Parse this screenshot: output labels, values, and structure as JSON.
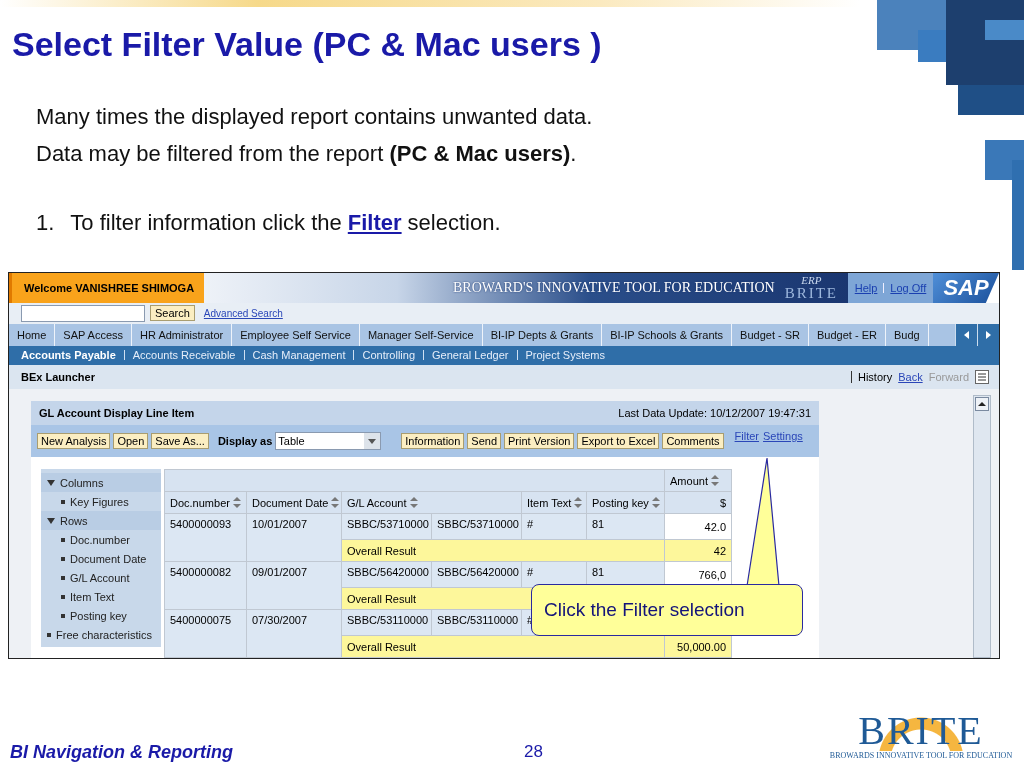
{
  "slide": {
    "title": "Select Filter Value (PC & Mac users )",
    "paragraphs": [
      "Many times the displayed report contains unwanted data.",
      "Data may be filtered from the report **(PC & Mac users)**."
    ],
    "step": {
      "number": "1.",
      "text_before": "To filter information click the",
      "link": "Filter",
      "text_after": "selection."
    }
  },
  "portal": {
    "welcome": "Welcome VANISHREE SHIMOGA",
    "banner": {
      "title": "BROWARD'S INNOVATIVE TOOL FOR EDUCATION",
      "erp": "ERP",
      "brand": "BRITE"
    },
    "header_links": [
      "Help",
      "Log Off"
    ],
    "sap_logo": "SAP",
    "search": {
      "button": "Search",
      "advanced": "Advanced Search"
    },
    "tabs": [
      {
        "label": "Home",
        "selected": false
      },
      {
        "label": "SAP Access",
        "selected": false
      },
      {
        "label": "HR Administrator",
        "selected": false
      },
      {
        "label": "Employee Self Service",
        "selected": false
      },
      {
        "label": "Manager Self-Service",
        "selected": false
      },
      {
        "label": "BI-IP Depts & Grants",
        "selected": false
      },
      {
        "label": "BI-IP Schools & Grants",
        "selected": false
      },
      {
        "label": "Budget - SR",
        "selected": false
      },
      {
        "label": "Budget - ER",
        "selected": false
      },
      {
        "label": "Budg",
        "selected": false
      }
    ],
    "subnav": [
      {
        "label": "Accounts Payable",
        "selected": true
      },
      {
        "label": "Accounts Receivable",
        "selected": false
      },
      {
        "label": "Cash Management",
        "selected": false
      },
      {
        "label": "Controlling",
        "selected": false
      },
      {
        "label": "General Ledger",
        "selected": false
      },
      {
        "label": "Project Systems",
        "selected": false
      }
    ],
    "launcher": {
      "title": "BEx Launcher",
      "history": "History",
      "back": "Back",
      "forward": {
        "label": "Forward",
        "disabled": true
      }
    },
    "report": {
      "title": "GL Account Display Line Item",
      "last_update": "Last Data Update: 10/12/2007 19:47:31",
      "buttons_left": [
        "New Analysis",
        "Open",
        "Save As..."
      ],
      "display_as_label": "Display as",
      "display_as_value": "Table",
      "buttons_right": [
        "Information",
        "Send",
        "Print Version",
        "Export to Excel",
        "Comments"
      ],
      "links": [
        "Filter",
        "Settings"
      ],
      "navigation": [
        {
          "label": "Columns",
          "expanded": true,
          "children": [
            {
              "label": "Key Figures"
            }
          ]
        },
        {
          "label": "Rows",
          "expanded": true,
          "children": [
            {
              "label": "Doc.number"
            },
            {
              "label": "Document Date"
            },
            {
              "label": "G/L Account"
            },
            {
              "label": "Item Text"
            },
            {
              "label": "Posting key"
            }
          ]
        },
        {
          "label": "Free characteristics",
          "expanded": false
        }
      ],
      "table": {
        "amount_heading": "Amount",
        "columns": [
          {
            "label": "Doc.number",
            "sortable": true,
            "kind": "single"
          },
          {
            "label": "Document Date",
            "sortable": true,
            "kind": "single"
          },
          {
            "label": "G/L Account",
            "sortable": true,
            "kind": "pair"
          },
          {
            "label": "Item Text",
            "sortable": true,
            "kind": "single"
          },
          {
            "label": "Posting key",
            "sortable": true,
            "kind": "single"
          },
          {
            "label": "$",
            "sortable": false,
            "kind": "single"
          }
        ],
        "rows": [
          {
            "doc": "5400000093",
            "date": "10/01/2007",
            "account_key": "SBBC/53710000",
            "account_text": "SBBC/53710000",
            "item_text": "#",
            "posting_key": "81",
            "amount": "42.0",
            "result_label": "Overall Result",
            "result_amount": "42"
          },
          {
            "doc": "5400000082",
            "date": "09/01/2007",
            "account_key": "SBBC/56420000",
            "account_text": "SBBC/56420000",
            "item_text": "#",
            "posting_key": "81",
            "amount": "766,0",
            "result_label": "Overall Result"
          },
          {
            "doc": "5400000075",
            "date": "07/30/2007",
            "account_key": "SBBC/53110000",
            "account_text": "SBBC/53110000",
            "item_text": "#",
            "result_label": "Overall Result",
            "result_amount": "50,000.00"
          }
        ]
      }
    },
    "callout": "Click the Filter selection"
  },
  "footer": {
    "left": "BI Navigation & Reporting",
    "page": "28",
    "logo": "BRITE",
    "logo_tagline": "BROWARDS INNOVATIVE TOOL FOR EDUCATION"
  }
}
